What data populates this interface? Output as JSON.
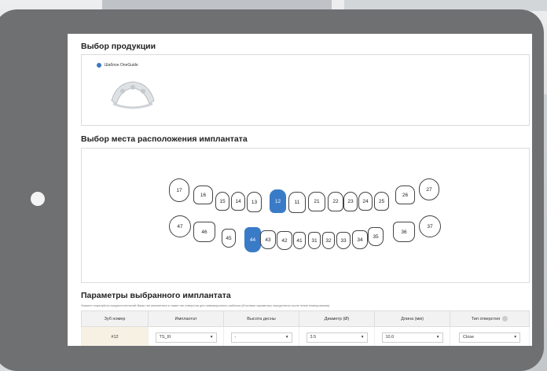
{
  "product_section": {
    "title": "Выбор продукции",
    "option_label": "Шаблон OneGuide"
  },
  "implant_site_section": {
    "title": "Выбор места расположения имплантата",
    "upper_teeth": [
      "17",
      "16",
      "15",
      "14",
      "13",
      "12",
      "11",
      "21",
      "22",
      "23",
      "24",
      "25",
      "26",
      "27"
    ],
    "lower_teeth": [
      "47",
      "46",
      "45",
      "44",
      "43",
      "42",
      "41",
      "31",
      "32",
      "33",
      "34",
      "35",
      "36",
      "37"
    ],
    "selected_teeth": [
      "12",
      "44"
    ]
  },
  "params_section": {
    "title": "Параметры выбранного имплантата",
    "hint": "Укажите пожалуйста предпочтительный Вами тип имплантата и также тип отверстия для навигационного шаблона (Итоговые параметры определятся после этапа планирования)",
    "columns": [
      "Зуб номер",
      "Имплантат",
      "Высота десны",
      "Диаметр (Ø)",
      "Длина (мм)",
      "Тип отверстия"
    ],
    "rows": [
      {
        "tooth": "#12",
        "implant": "TS_III",
        "gum_height": "-",
        "diameter": "3.5",
        "length": "10.0",
        "hole_type": "Close"
      }
    ]
  },
  "colors": {
    "accent": "#3a7bc8",
    "tablet_frame": "#6e7072"
  }
}
